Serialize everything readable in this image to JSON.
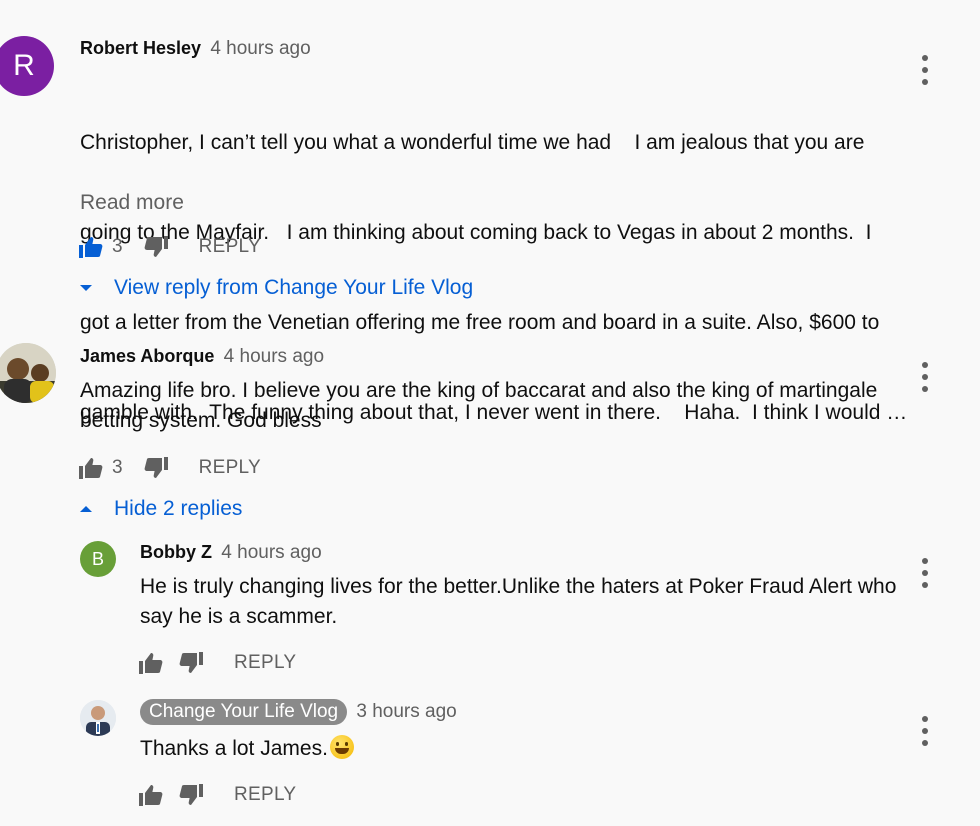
{
  "colors": {
    "background": "#f9f9f9",
    "link_blue": "#065fd4",
    "secondary_text": "#606060",
    "avatar_robert": "#7b1fa2",
    "avatar_bobby": "#689f38",
    "owner_chip": "#8a8a8a"
  },
  "comments": [
    {
      "avatar_letter": "R",
      "author": "Robert Hesley",
      "time": "4 hours ago",
      "lines": [
        "Christopher, I can’t tell you what a wonderful time we had    I am jealous that you are",
        "going to the Mayfair.   I am thinking about coming back to Vegas in about 2 months.  I",
        "got a letter from the Venetian offering me free room and board in a suite. Also, $600 to",
        "gamble with.  The funny thing about that, I never went in there.    Haha.  I think I would …"
      ],
      "read_more": "Read more",
      "likes": "3",
      "liked": true,
      "reply_label": "REPLY",
      "toggle_label": "View reply from Change Your Life Vlog"
    },
    {
      "author": "James Aborque",
      "time": "4 hours ago",
      "lines": [
        "Amazing life bro. I believe you are the king of baccarat and also the king of martingale",
        "betting system. God bless"
      ],
      "likes": "3",
      "liked": false,
      "reply_label": "REPLY",
      "toggle_label": "Hide 2 replies"
    }
  ],
  "replies": [
    {
      "avatar_letter": "B",
      "author": "Bobby Z",
      "time": "4 hours ago",
      "lines": [
        "He is truly changing lives for the better.Unlike the haters at Poker Fraud Alert who",
        "say he is a scammer."
      ],
      "likes": "",
      "reply_label": "REPLY"
    },
    {
      "author": "Change Your Life Vlog",
      "time": "3 hours ago",
      "text": "Thanks a lot James.",
      "emoji": "grinning-face-emoji",
      "likes": "",
      "reply_label": "REPLY"
    }
  ],
  "icons": {
    "like": "thumb-up-icon",
    "dislike": "thumb-down-icon",
    "menu": "more-vertical-icon",
    "expand": "caret-down-icon",
    "collapse": "caret-up-icon"
  }
}
